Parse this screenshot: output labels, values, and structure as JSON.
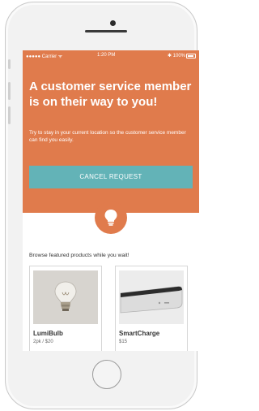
{
  "status_bar": {
    "carrier": "●●●●● Carrier ⁠ᯤ",
    "time": "1:20 PM",
    "battery": "⁠✱ 100%"
  },
  "hero": {
    "title": "A customer service member is on their way to you!",
    "subtitle": "Try to stay in your current location so the customer service member can find you easily.",
    "cancel_label": "CANCEL REQUEST"
  },
  "browse": {
    "label": "Browse featured products while you wait!"
  },
  "products": [
    {
      "name": "LumiBulb",
      "meta": "2pk / $20"
    },
    {
      "name": "SmartCharge",
      "meta": "$15"
    }
  ],
  "colors": {
    "accent": "#e07b4c",
    "button": "#63b3b7"
  }
}
